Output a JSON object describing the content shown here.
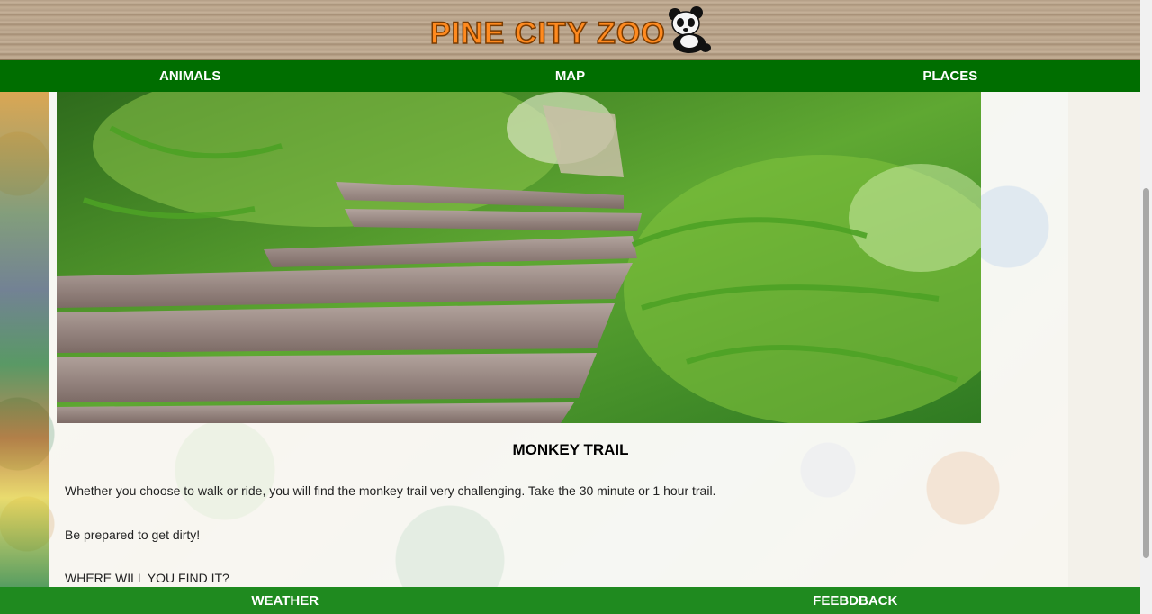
{
  "header": {
    "logo_text": "PINE CITY ZOO",
    "logo_colors": {
      "fill": "#ff8a1f",
      "outline": "#7a3b00"
    },
    "mascot_icon": "panda-icon"
  },
  "top_nav": {
    "items": [
      {
        "label": "ANIMALS"
      },
      {
        "label": "MAP"
      },
      {
        "label": "PLACES"
      }
    ],
    "background": "#006e00"
  },
  "main": {
    "hero_image": "wooden-boardwalk-through-ferns",
    "title": "MONKEY TRAIL",
    "paragraphs": [
      "Whether you choose to walk or ride, you will find the monkey trail very challenging. Take the 30 minute or 1 hour trail.",
      "Be prepared to get dirty!",
      "WHERE WILL YOU FIND IT?"
    ]
  },
  "bottom_nav": {
    "items": [
      {
        "label": "WEATHER"
      },
      {
        "label": "FEEBDBACK"
      }
    ],
    "background": "#1f8a1f"
  }
}
